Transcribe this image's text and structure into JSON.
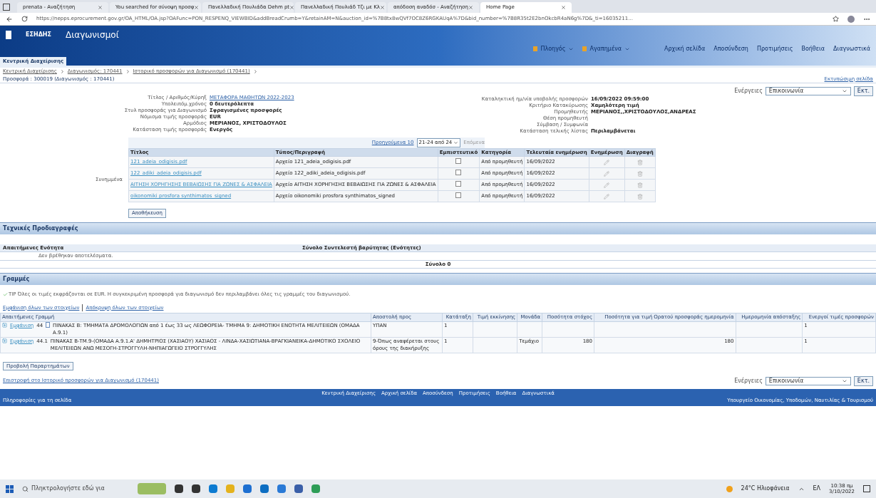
{
  "browser": {
    "tabs": [
      {
        "label": "prenata - Αναζήτηση",
        "selected": false
      },
      {
        "label": "You searched for σύνοψη προσφ",
        "selected": false
      },
      {
        "label": "Πανελλαδική Πουλιάδα Dehm pt",
        "selected": false
      },
      {
        "label": "Πανελλαδική Πουλιάδ Τζι με Κλ",
        "selected": false
      },
      {
        "label": "απόδοση αναδόσ - Αναζήτηση",
        "selected": false
      },
      {
        "label": "Home Page",
        "selected": true
      }
    ],
    "url": "https://nepps.eprocurement.gov.gr/OA_HTML/OA.jsp?OAFunc=PON_RESPENQ_VIEWBID&addBreadCrumb=Y&retainAM=N&auction_id=%7B8tx8wQVf7OC8Z6RGKAUqA%7D&bid_number=%7B8R35t2E2bnOkcbR4aN6g%7D&_ti=16035211..."
  },
  "header": {
    "brand": "ΕΣΗΔΗΣ",
    "title": "Διαγωνισμοί",
    "menus": [
      "Πλοηγός",
      "Αγαπημένα"
    ],
    "links": [
      "Αρχική σελίδα",
      "Αποσύνδεση",
      "Προτιμήσεις",
      "Βοήθεια",
      "Διαγνωστικά"
    ],
    "tab": "Κεντρική Διαχείρισης"
  },
  "breadcrumb": [
    "Κεντρική Διαχείρισης",
    "Διαγωνισμός: 170441",
    "Ιστορικό προσφορών για Διαγωνισμό (170441)"
  ],
  "page_title": "Προσφορά : 300019 (Διαγωνισμός : 170441)",
  "printable_link": "Εκτυπώσιμη σελίδα",
  "view_select": {
    "label": "Ενέργειες",
    "value": "Επικοινωνία",
    "button": "Εκτ."
  },
  "details_left": [
    {
      "label": "Τίτλος / Αριθμός/Κύρηξ",
      "value": "ΜΕΤΑΦΟΡΑ ΜΑΘΗΤΩΝ 2022-2023",
      "kind": "link"
    },
    {
      "label": "Υπολειπόμ.χρόνος",
      "value": "0 δευτερόλεπτα",
      "kind": "bold"
    },
    {
      "label": "Στυλ προσφοράς για Διαγωνισμό",
      "value": "Σφραγισμένες προσφορές",
      "kind": "bold"
    },
    {
      "label": "Νόμισμα τιμής προσφοράς",
      "value": "EUR",
      "kind": "bold"
    },
    {
      "label": "Αρμόδιος",
      "value": "ΜΕΡΙΑΝΟΣ, ΧΡΙΣΤΟΔΟΥΛΟΣ",
      "kind": "bold"
    },
    {
      "label": "Κατάσταση τιμής προσφοράς",
      "value": "Ενεργός",
      "kind": "bold"
    }
  ],
  "details_right": [
    {
      "label": "Καταληκτική ημ/νία υποβολής προσφορών",
      "value": "16/09/2022 09:59:00"
    },
    {
      "label": "Κριτήριο Κατακύρωσης",
      "value": "Χαμηλότερη τιμή"
    },
    {
      "label": "Προμηθευτής",
      "value": "ΜΕΡΙΑΝΟΣ,,ΧΡΙΣΤΟΔΟΥΛΟΣ,ΑΝΔΡΕΑΣ"
    },
    {
      "label": "Θέση προμηθευτή"
    },
    {
      "label": "Σύμβαση / Συμφωνία"
    },
    {
      "label": "Κατάσταση τελικής λίστας",
      "value": "Περιλαμβάνεται"
    }
  ],
  "attachments": {
    "label": "Συνημμένα",
    "prev": "Προηγούμενα 10",
    "range": "21-24 από 24",
    "next": "Επόμενα",
    "columns": [
      "Τίτλος",
      "Τύπος/Περιγραφή",
      "Εμπιστευτικό",
      "Κατηγορία",
      "Τελευταία ενημέρωση",
      "Ενημέρωση",
      "Διαγραφή"
    ],
    "rows": [
      {
        "title": "121_adeia_odigisis.pdf",
        "desc": "Αρχείο 121_adeia_odigisis.pdf",
        "confidential": false,
        "category": "Από προμηθευτή",
        "updated": "16/09/2022"
      },
      {
        "title": "122_adiki_adeia_odigisis.pdf",
        "desc": "Αρχείο 122_adiki_adeia_odigisis.pdf",
        "confidential": false,
        "category": "Από προμηθευτή",
        "updated": "16/09/2022"
      },
      {
        "title": "ΑΙΤΗΣΗ ΧΟΡΗΓΗΣΗΣ ΒΕΒΑΙΩΣΗΣ ΓΙΑ ΖΩΝΕΣ & ΑΣΦΑΛΕΙΑ",
        "desc": "Αρχείο ΑΙΤΗΣΗ ΧΟΡΗΓΗΣΗΣ ΒΕΒΑΙΩΣΗΣ ΓΙΑ ΖΩΝΕΣ & ΑΣΦΑΛΕΙΑ",
        "confidential": false,
        "category": "Από προμηθευτή",
        "updated": "16/09/2022"
      },
      {
        "title": "oikonomiki prosfora synthimatos_signed",
        "desc": "Αρχείο oikonomiki prosfora synthimatos_signed",
        "confidential": false,
        "category": "Από προμηθευτή",
        "updated": "16/09/2022"
      }
    ],
    "save": "Αποθήκευση"
  },
  "tech": {
    "title": "Τεχνικές Προδιαγραφές",
    "columns": [
      "Απαιτήμενες Ενότητα",
      "Σύνολο Συντελεστή βαρύτητας (Ενότητες)"
    ],
    "empty": "Δεν βρέθηκαν αποτελέσματα.",
    "total": "Σύνολο 0"
  },
  "lines": {
    "title": "Γραμμές",
    "tip_label": "TIP",
    "tip": "Όλες οι τιμές εκφράζονται σε EUR. Η συγκεκριμένη προσφορά για διαγωνισμό δεν περιλαμβάνει όλες τις γραμμές του διαγωνισμού.",
    "expand_all": "Εμφάνιση όλων των στοιχείων",
    "collapse_all": "Απόκρυψη όλων των στοιχείων",
    "columns": [
      "Απαιτήμενες Γραμμή",
      "Αποστολή προς",
      "Κατάταξη",
      "Τιμή εκκίνησης",
      "Μονάδα",
      "Ποσότητα στόχος",
      "Ποσότητα για τιμή Ορατού προσφοράς ημερομηνία",
      "Ημερομηνία απόσταξης",
      "Ενεργοί τιμές προσφορών"
    ],
    "rows": [
      {
        "toggle": "Εμφάνιση",
        "line": "44",
        "desc": "ΠΙΝΑΚΑΣ Β: ΤΜΗΜΑΤΑ ΔΡΟΜΟΛΟΓΙΩΝ από 1 έως 33 ως ΛΕΩΦΟΡΕΙΑ- ΤΜΗΜΑ 9: ΔΗΜΟΤΙΚΗ ΕΝΟΤΗΤΑ ΜΕΛΙΤΕΙΕΩΝ (ΟΜΑΔΑ Α.9.1)",
        "ship": "ΥΠΑΝ",
        "rank": "1",
        "start": "",
        "unit": "",
        "qty": "",
        "qty2": "",
        "date": "",
        "active": "1",
        "has_icon": true
      },
      {
        "toggle": "Εμφάνιση",
        "line": "44.1",
        "desc": "ΠΙΝΑΚΑΣ Β-ΤΜ.9-(ΟΜΑΔΑ Α.9.1.Α' ΔΗΜΗΤΡΙΟΣ (ΧΑΣΙΑΟΥ) ΧΑΣΙΑΟΣ - ΛΙΝΔΑ-ΧΑΣΙΩΤΙΑΝΑ-ΒΡΑΓΚΙΑΝΕΙΚΑ-ΔΗΜΟΤΙΚΟ ΣΧΟΛΕΙΟ ΜΕΛΙΤΕΙΕΩΝ ΑΝΩ ΜΕΣΟΓΗ-ΣΤΡΟΓΓΥΛΗ-ΝΗΠΙΑΓΩΓΕΙΟ ΣΤΡΟΓΓΥΛΗΣ",
        "ship": "9-Όπως αναφέρεται στους όρους της διακήρυξης",
        "rank": "1",
        "start": "",
        "unit": "Τεμάχιο",
        "qty": "180",
        "qty2": "180",
        "date": "",
        "active": "1",
        "has_icon": false
      }
    ],
    "view_button": "Προβολή Παραρτημάτων"
  },
  "return_link": "Επιστροφή στο Ιστορικό προσφορών για Διαγωνισμό (170441)",
  "bottom_select": {
    "label": "Ενέργειες",
    "value": "Επικοινωνία",
    "button": "Εκτ."
  },
  "footer": {
    "links": [
      "Κεντρική Διαχείρισης",
      "Αρχική σελίδα",
      "Αποσύνδεση",
      "Προτιμήσεις",
      "Βοήθεια",
      "Διαγνωστικά"
    ],
    "about": "Πληροφορίες για τη σελίδα",
    "ministry": "Υπουργείο Οικονομίας, Υποδομών, Ναυτιλίας & Τουρισμού"
  },
  "taskbar": {
    "search": "Πληκτρολογήστε εδώ για",
    "weather": "24°C Ηλιοφάνεια",
    "lang": "ΕΛ",
    "time": "10:38 πμ",
    "date": "3/10/2022"
  }
}
